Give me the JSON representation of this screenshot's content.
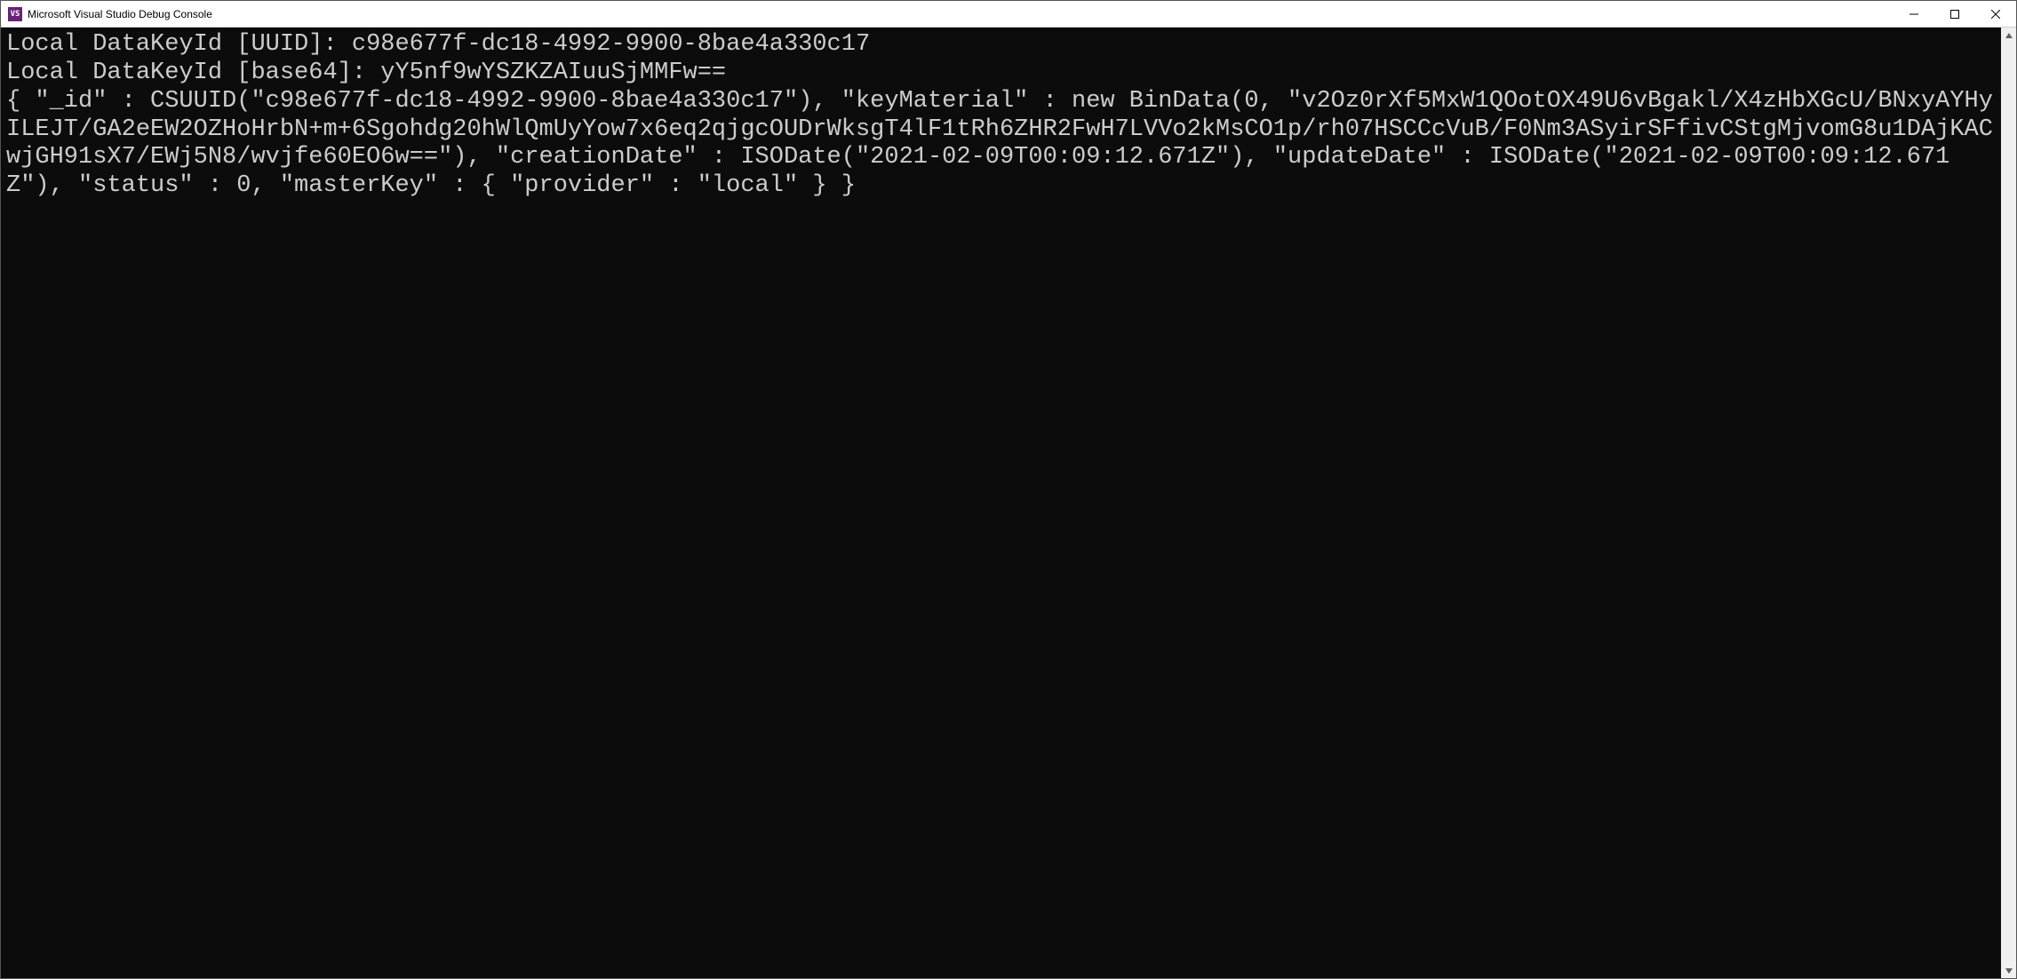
{
  "window": {
    "title": "Microsoft Visual Studio Debug Console",
    "icon_label": "VS"
  },
  "console": {
    "output": "Local DataKeyId [UUID]: c98e677f-dc18-4992-9900-8bae4a330c17\nLocal DataKeyId [base64]: yY5nf9wYSZKZAIuuSjMMFw==\n{ \"_id\" : CSUUID(\"c98e677f-dc18-4992-9900-8bae4a330c17\"), \"keyMaterial\" : new BinData(0, \"v2Oz0rXf5MxW1QOotOX49U6vBgakl/X4zHbXGcU/BNxyAYHyILEJT/GA2eEW2OZHoHrbN+m+6Sgohdg20hWlQmUyYow7x6eq2qjgcOUDrWksgT4lF1tRh6ZHR2FwH7LVVo2kMsCO1p/rh07HSCCcVuB/F0Nm3ASyirSFfivCStgMjvomG8u1DAjKACwjGH91sX7/EWj5N8/wvjfe60EO6w==\"), \"creationDate\" : ISODate(\"2021-02-09T00:09:12.671Z\"), \"updateDate\" : ISODate(\"2021-02-09T00:09:12.671Z\"), \"status\" : 0, \"masterKey\" : { \"provider\" : \"local\" } }"
  }
}
